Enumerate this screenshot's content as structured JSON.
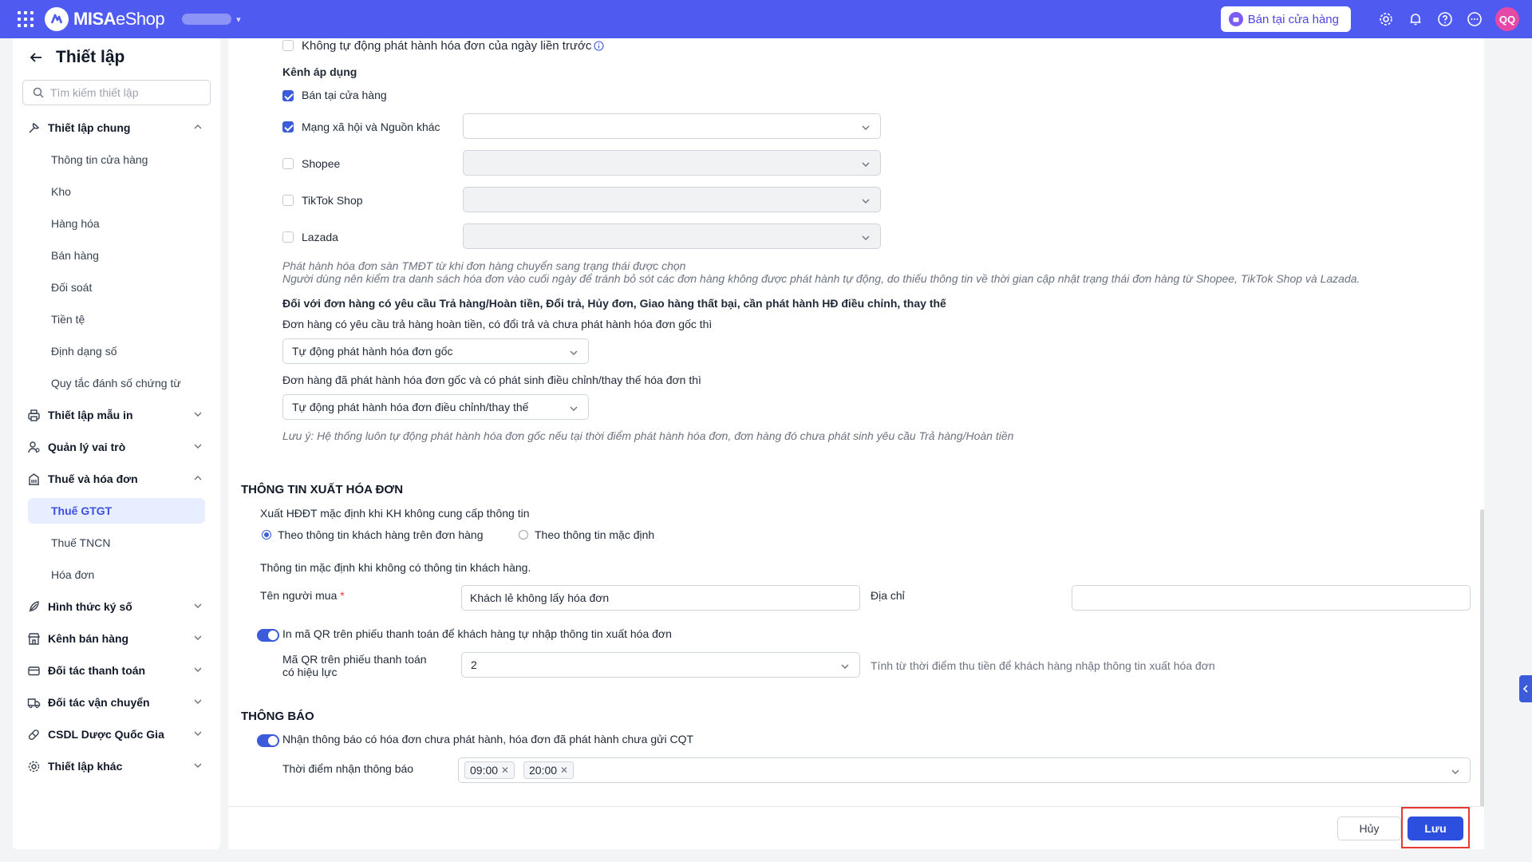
{
  "header": {
    "logo_brand": "MISA",
    "logo_product": "eShop",
    "store_button": "Bán tại cửa hàng",
    "avatar_initials": "QQ",
    "brand_color": "#4f5bf0"
  },
  "sidebar": {
    "title": "Thiết lập",
    "search_placeholder": "Tìm kiếm thiết lập",
    "general": {
      "label": "Thiết lập chung",
      "items": [
        "Thông tin cửa hàng",
        "Kho",
        "Hàng hóa",
        "Bán hàng",
        "Đối soát",
        "Tiền tệ",
        "Định dạng số",
        "Quy tắc đánh số chứng từ"
      ]
    },
    "print_templates": "Thiết lập mẫu in",
    "roles": "Quản lý vai trò",
    "tax_invoice": {
      "label": "Thuế và hóa đơn",
      "items": [
        "Thuế GTGT",
        "Thuế TNCN",
        "Hóa đơn"
      ],
      "active": "Thuế GTGT"
    },
    "signing": "Hình thức ký số",
    "sales_channels": "Kênh bán hàng",
    "payment_partners": "Đối tác thanh toán",
    "shipping_partners": "Đối tác vận chuyển",
    "pharma_db": "CSDL Dược Quốc Gia",
    "other_settings": "Thiết lập khác"
  },
  "content": {
    "auto_issue_label": "Không tự động phát hành hóa đơn của ngày liền trước",
    "channels_heading": "Kênh áp dụng",
    "channels": [
      {
        "label": "Bán tại cửa hàng",
        "checked": true
      },
      {
        "label": "Mạng xã hội và Nguồn khác",
        "checked": true
      },
      {
        "label": "Shopee",
        "checked": false
      },
      {
        "label": "TikTok Shop",
        "checked": false
      },
      {
        "label": "Lazada",
        "checked": false
      }
    ],
    "marketplace_hint_1": "Phát hành hóa đơn sàn TMĐT từ khi đơn hàng chuyển sang trạng thái được chọn",
    "marketplace_hint_2": "Người dùng nên kiểm tra danh sách hóa đơn vào cuối ngày để tránh bỏ sót các đơn hàng không được phát hành tự động, do thiếu thông tin về thời gian cập nhật trạng thái đơn hàng từ Shopee, TikTok Shop và Lazada.",
    "returns_heading": "Đối với đơn hàng có yêu cầu Trả hàng/Hoàn tiền, Đổi trả, Hủy đơn, Giao hàng thất bại, cần phát hành HĐ điều chỉnh, thay thế",
    "returns_q1": "Đơn hàng có yêu cầu trả hàng hoàn tiền, có đổi trả và chưa phát hành hóa đơn gốc thì",
    "returns_a1": "Tự động phát hành hóa đơn gốc",
    "returns_q2": "Đơn hàng đã phát hành hóa đơn gốc và có phát sinh điều chỉnh/thay thế hóa đơn thì",
    "returns_a2": "Tự động phát hành hóa đơn điều chỉnh/thay thế",
    "returns_note": "Lưu ý: Hệ thống luôn tự động phát hành hóa đơn gốc nếu tại thời điểm phát hành hóa đơn, đơn hàng đó chưa phát sinh yêu cầu Trả hàng/Hoàn tiền",
    "invoice_info_heading": "THÔNG TIN XUẤT HÓA ĐƠN",
    "default_export_label": "Xuất HĐĐT mặc định khi KH không cung cấp thông tin",
    "radio_customer": "Theo thông tin khách hàng trên đơn hàng",
    "radio_default": "Theo thông tin mặc định",
    "default_info_label": "Thông tin mặc định khi không có thông tin khách hàng.",
    "buyer_label": "Tên người mua",
    "required_mark": "*",
    "buyer_value": "Khách lẻ không lấy hóa đơn",
    "address_label": "Địa chỉ",
    "address_value": "",
    "qr_toggle_label": "In mã QR trên phiếu thanh toán để khách hàng tự nhập thông tin xuất hóa đơn",
    "qr_validity_label_1": "Mã QR trên phiếu thanh toán",
    "qr_validity_label_2": "có hiệu lực",
    "qr_validity_value": "2",
    "qr_validity_hint": "Tính từ thời điểm thu tiền để khách hàng nhập thông tin xuất hóa đơn",
    "notify_heading": "THÔNG BÁO",
    "notify_toggle_label": "Nhận thông báo có hóa đơn chưa phát hành, hóa đơn đã phát hành chưa gửi CQT",
    "notify_time_label": "Thời điểm nhận thông báo",
    "notify_times": [
      "09:00",
      "20:00"
    ]
  },
  "footer": {
    "cancel": "Hủy",
    "save": "Lưu"
  }
}
